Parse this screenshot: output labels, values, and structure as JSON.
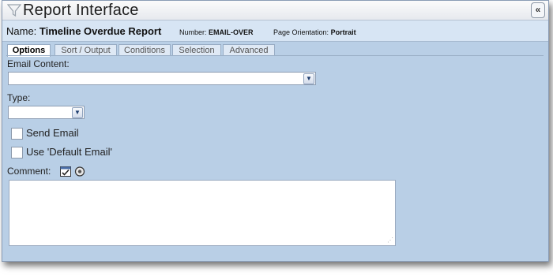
{
  "window": {
    "title": "Report Interface",
    "collapse_symbol": "«"
  },
  "report": {
    "name_label": "Name:",
    "name_value": "Timeline Overdue Report",
    "number_label": "Number:",
    "number_value": "EMAIL-OVER",
    "orientation_label": "Page Orientation:",
    "orientation_value": "Portrait"
  },
  "tabs": [
    {
      "label": "Options",
      "active": true
    },
    {
      "label": "Sort / Output",
      "active": false
    },
    {
      "label": "Conditions",
      "active": false
    },
    {
      "label": "Selection",
      "active": false
    },
    {
      "label": "Advanced",
      "active": false
    }
  ],
  "form": {
    "email_content_label": "Email Content:",
    "email_content_value": "",
    "type_label": "Type:",
    "type_value": "",
    "send_email_label": "Send Email",
    "send_email_checked": false,
    "use_default_email_label": "Use 'Default Email'",
    "use_default_email_checked": false,
    "comment_label": "Comment:",
    "comment_value": ""
  },
  "icons": {
    "title": "filter-icon",
    "comment_edit": "edit-calendar-icon",
    "comment_help": "help-globe-icon"
  },
  "colors": {
    "panel_background": "#b9cfe6",
    "namebar_background": "#d7e5f4"
  }
}
